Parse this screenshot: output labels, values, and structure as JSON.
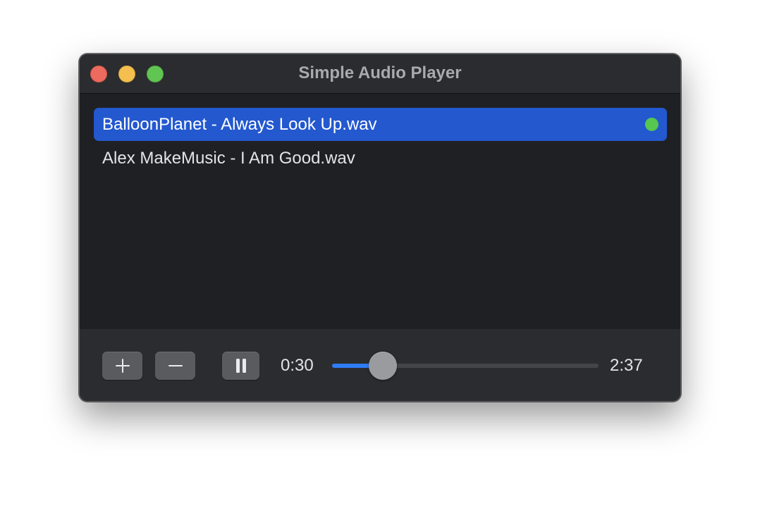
{
  "window": {
    "title": "Simple Audio Player",
    "traffic_lights": {
      "close": "#ec6a5e",
      "minimize": "#f4bf4f",
      "zoom": "#61c554"
    }
  },
  "playlist": {
    "items": [
      {
        "label": "BalloonPlanet - Always Look Up.wav",
        "selected": true,
        "playing": true
      },
      {
        "label": "Alex MakeMusic - I Am Good.wav",
        "selected": false,
        "playing": false
      }
    ],
    "selection_color": "#2358cf",
    "playing_indicator_color": "#56c74f"
  },
  "controls": {
    "add_icon": "plus-icon",
    "remove_icon": "minus-icon",
    "playpause_icon": "pause-icon",
    "elapsed": "0:30",
    "total": "2:37",
    "progress_fraction": 0.19,
    "progress_color": "#2f7cf6"
  }
}
